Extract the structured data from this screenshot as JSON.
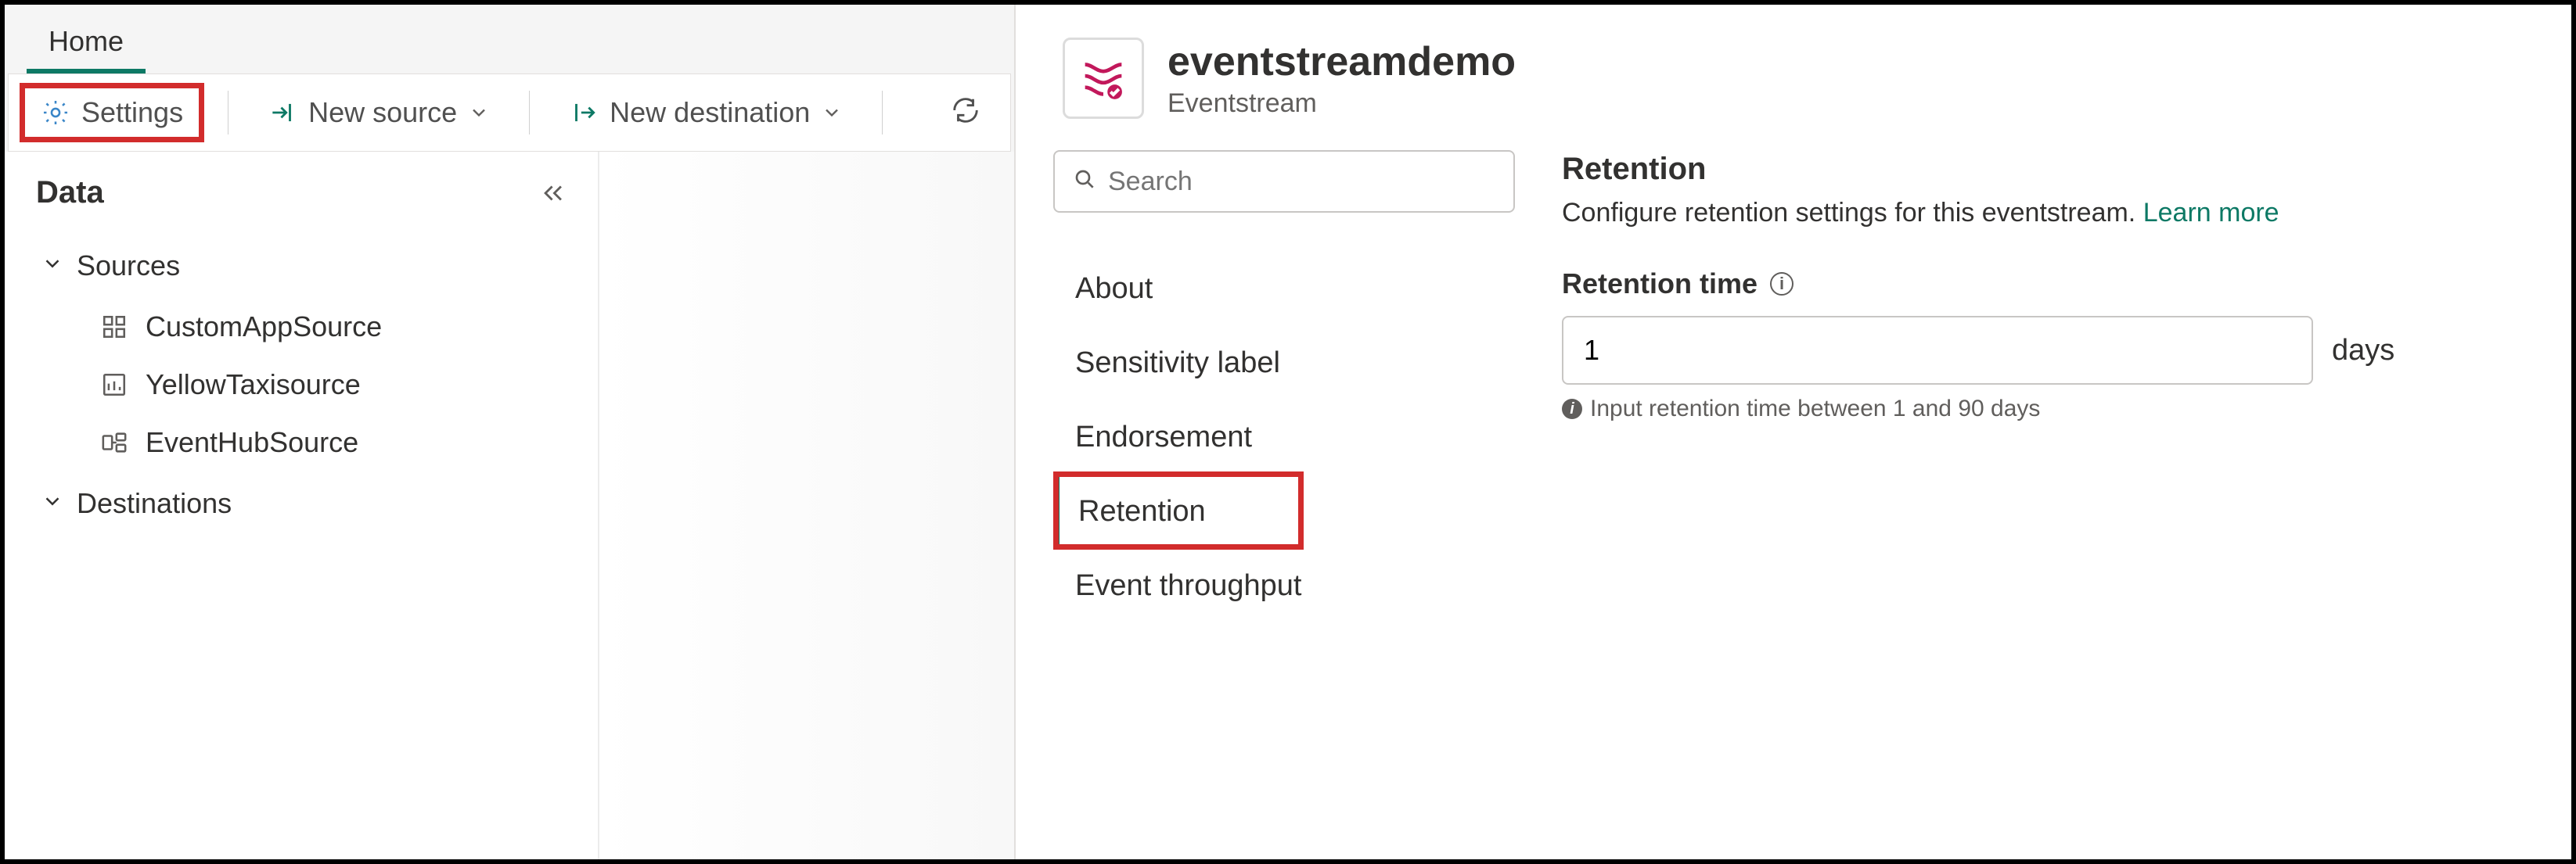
{
  "tabs": {
    "home": "Home"
  },
  "toolbar": {
    "settings": "Settings",
    "new_source": "New source",
    "new_destination": "New destination"
  },
  "sidebar": {
    "title": "Data",
    "groups": {
      "sources": "Sources",
      "destinations": "Destinations"
    },
    "sources": [
      "CustomAppSource",
      "YellowTaxisource",
      "EventHubSource"
    ]
  },
  "entity": {
    "title": "eventstreamdemo",
    "type": "Eventstream"
  },
  "settings_nav": {
    "search_placeholder": "Search",
    "items": {
      "about": "About",
      "sensitivity": "Sensitivity label",
      "endorsement": "Endorsement",
      "retention": "Retention",
      "throughput": "Event throughput"
    }
  },
  "retention": {
    "heading": "Retention",
    "description": "Configure retention settings for this eventstream. ",
    "learn_more": "Learn more",
    "field_label": "Retention time",
    "value": "1",
    "unit": "days",
    "hint": "Input retention time between 1 and 90 days"
  }
}
